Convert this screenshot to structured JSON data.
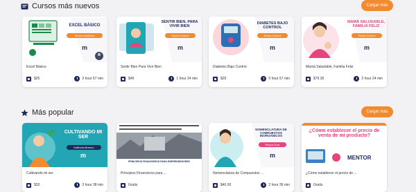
{
  "sections": [
    {
      "title": "Cursos más nuevos",
      "load_more": "Cargar más",
      "courses": [
        {
          "name": "Excel Básico",
          "price": "$25",
          "duration": "3 hour 57 min",
          "banner": "EXCEL BÁSICO",
          "teacher": "Nelson Martínez"
        },
        {
          "name": "Sentir Bien Para Vivir Bien",
          "price": "$49",
          "duration": "1 hour 24 min",
          "banner": "SENTIR BIEN, PARA VIVIR BIEN",
          "teacher": "Eloisa Gómez"
        },
        {
          "name": "Diabetes Bajo Control",
          "price": "$29",
          "duration": "0 hour 57 min",
          "banner": "DIABETES BAJO CONTROL",
          "teacher": "Eloisa Gómez"
        },
        {
          "name": "Mamá Saludable, Familia Feliz",
          "price": "$79.30",
          "duration": "2 hour 24 min",
          "banner": "MAMÁ SALUDABLE, FAMILIA FELIZ",
          "teacher": "Eloisa Gómez"
        }
      ]
    },
    {
      "title": "Más popular",
      "load_more": "Cargar más",
      "courses": [
        {
          "name": "Cultivando mi ser",
          "price": "$33",
          "duration": "3 hour 38 min",
          "banner": "CULTIVANDO MI SER",
          "teacher": "Katlinda Moreno"
        },
        {
          "name": "Principios Financieros para ...",
          "price": "Gratis",
          "duration": "",
          "banner": "PRINCIPIOS FINANCIEROS PARA EMPRENDEDORES",
          "teacher": ""
        },
        {
          "name": "Nomenclatura de Compuestos ...",
          "price": "$40.00",
          "duration": "2 hour 36 min",
          "banner": "NOMENCLATURA DE COMPUESTOS INORGÁNICOS",
          "teacher": "Reyna Díaz"
        },
        {
          "name": "¿Cómo establecer el precio de ...",
          "price": "Gratis",
          "duration": "",
          "banner": "¿Cómo establecer el precio de venta de mi producto?",
          "teacher": ""
        }
      ]
    }
  ],
  "brand": {
    "logo_letter": "m",
    "name": "MENTOR"
  },
  "colors": {
    "accent": "#f28a2e",
    "navy": "#1f2a5a",
    "teal": "#23a6b3",
    "pink": "#e6457c"
  }
}
